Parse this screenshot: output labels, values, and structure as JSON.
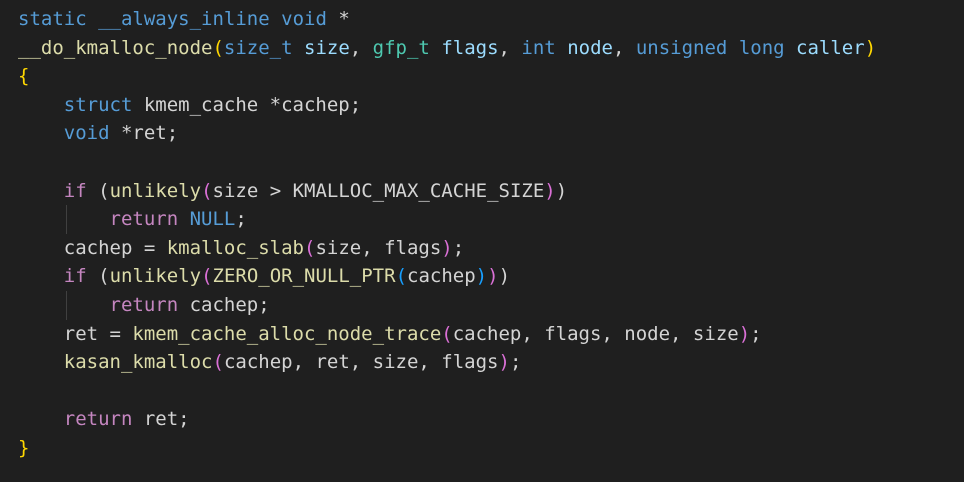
{
  "code": {
    "line1": {
      "k_static": "static",
      "sp1": " ",
      "t_always": "__always_inline",
      "sp2": " ",
      "k_void": "void",
      "t_star": " *"
    },
    "line2": {
      "f_name": "__do_kmalloc_node",
      "p_open": "(",
      "t_size_t": "size_t",
      "sp1": " ",
      "p_size": "size",
      "t_c1": ", ",
      "t_gfp": "gfp_t",
      "sp2": " ",
      "p_flags": "flags",
      "t_c2": ", ",
      "k_int": "int",
      "sp3": " ",
      "p_node": "node",
      "t_c3": ", ",
      "k_unsigned": "unsigned",
      "sp4": " ",
      "k_long": "long",
      "sp5": " ",
      "p_caller": "caller",
      "p_close": ")"
    },
    "line3": {
      "b_open": "{"
    },
    "line4": {
      "k_struct": "struct",
      "t_rest": " kmem_cache *cachep;"
    },
    "line5": {
      "k_void": "void",
      "t_rest": " *ret;"
    },
    "line7": {
      "k_if": "if",
      "t_sp": " ",
      "b_open": "(",
      "f_unlikely": "unlikely",
      "b2_open": "(",
      "t_expr": "size > KMALLOC_MAX_CACHE_SIZE",
      "b2_close": ")",
      "b_close": ")"
    },
    "line8": {
      "k_return": "return",
      "t_sp": " ",
      "m_null": "NULL",
      "t_semi": ";"
    },
    "line9": {
      "t_a": "cachep = ",
      "f_slab": "kmalloc_slab",
      "b_open": "(",
      "t_args": "size, flags",
      "b_close": ")",
      "t_semi": ";"
    },
    "line10": {
      "k_if": "if",
      "t_sp": " ",
      "b_open": "(",
      "f_unlikely": "unlikely",
      "b2_open": "(",
      "m_zero": "ZERO_OR_NULL_PTR",
      "b3_open": "(",
      "t_arg": "cachep",
      "b3_close": ")",
      "b2_close": ")",
      "b_close": ")"
    },
    "line11": {
      "k_return": "return",
      "t_rest": " cachep;"
    },
    "line12": {
      "t_a": "ret = ",
      "f_alloc": "kmem_cache_alloc_node_trace",
      "b_open": "(",
      "t_args": "cachep, flags, node, size",
      "b_close": ")",
      "t_semi": ";"
    },
    "line13": {
      "f_kasan": "kasan_kmalloc",
      "b_open": "(",
      "t_args": "cachep, ret, size, flags",
      "b_close": ")",
      "t_semi": ";"
    },
    "line15": {
      "k_return": "return",
      "t_rest": " ret;"
    },
    "line16": {
      "b_close": "}"
    }
  },
  "colors": {
    "background": "#1f1f1f",
    "keyword": "#569cd6",
    "control": "#c586c0",
    "function": "#dcdcaa",
    "type": "#4ec9b0",
    "parameter": "#9cdcfe",
    "text": "#d4d4d4",
    "bracket_gold": "#ffd700",
    "bracket_orchid": "#da70d6",
    "bracket_blue": "#179fff"
  }
}
